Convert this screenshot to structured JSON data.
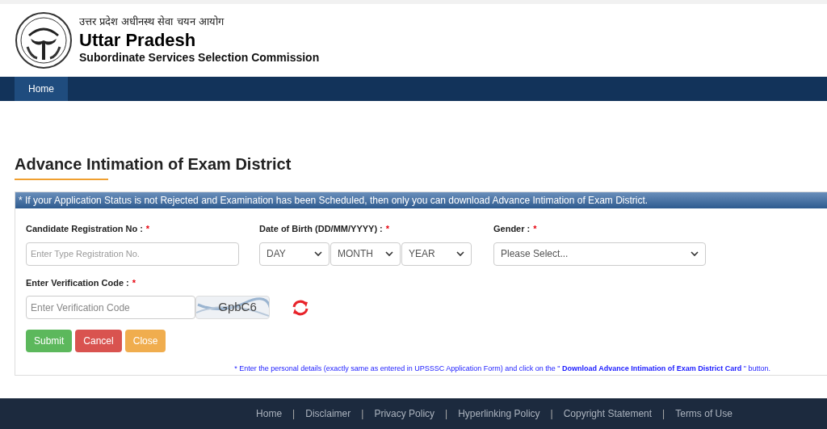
{
  "header": {
    "hindi_title": "उत्तर प्रदेश अधीनस्थ सेवा चयन आयोग",
    "title": "Uttar Pradesh",
    "subtitle": "Subordinate Services Selection Commission"
  },
  "nav": [
    {
      "label": "Home",
      "selected": true
    }
  ],
  "page_title": "Advance Intimation of Exam District",
  "notice": "* If your Application Status is not Rejected and Examination has been Scheduled, then only you can download Advance Intimation of Exam District.",
  "form": {
    "registration": {
      "label": "Candidate Registration No :",
      "required": "*",
      "placeholder": "Enter Type Registration No."
    },
    "dob": {
      "label": "Date of Birth (DD/MM/YYYY) :",
      "required": "*",
      "selects": [
        "DAY",
        "MONTH",
        "YEAR"
      ]
    },
    "gender": {
      "label": "Gender :",
      "required": "*",
      "value": "Please Select..."
    },
    "verification": {
      "label": "Enter Verification Code :",
      "required": "*",
      "placeholder": "Enter Verification Code",
      "captcha": "GpbC6"
    },
    "buttons": [
      {
        "label": "Submit",
        "kind": "submit"
      },
      {
        "label": "Cancel",
        "kind": "cancel"
      },
      {
        "label": "Close",
        "kind": "close"
      }
    ],
    "note": "* Enter the personal details (exactly same as entered in UPSSSC Application Form) and click on the \" **Download Advance Intimation of Exam District Card** \" button."
  },
  "footer": [
    {
      "label": "Home"
    },
    {
      "separator": "|",
      "label": "Disclaimer"
    },
    {
      "separator": "|",
      "label": "Privacy Policy"
    },
    {
      "separator": "|",
      "label": "Hyperlinking Policy"
    },
    {
      "separator": "|",
      "label": "Copyright Statement"
    },
    {
      "separator": "|",
      "label": "Terms of Use"
    }
  ]
}
